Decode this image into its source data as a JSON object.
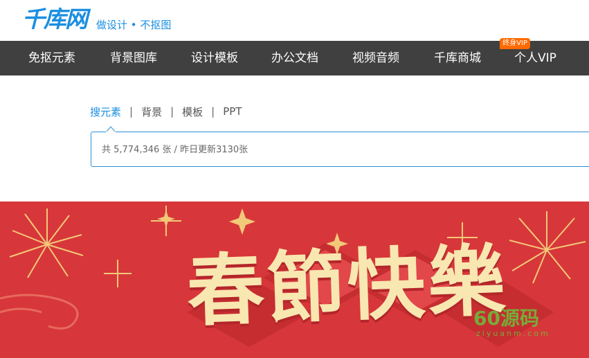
{
  "header": {
    "logo_text": "千库网",
    "tagline": "做设计 • 不抠图"
  },
  "nav": {
    "items": [
      {
        "label": "免抠元素"
      },
      {
        "label": "背景图库"
      },
      {
        "label": "设计模板"
      },
      {
        "label": "办公文档"
      },
      {
        "label": "视频音频"
      },
      {
        "label": "千库商城"
      },
      {
        "label": "个人VIP"
      }
    ],
    "vip_badge": "终身VIP"
  },
  "search": {
    "tabs": [
      {
        "label": "搜元素",
        "active": true
      },
      {
        "label": "背景",
        "active": false
      },
      {
        "label": "模板",
        "active": false
      },
      {
        "label": "PPT",
        "active": false
      }
    ],
    "separator": "|",
    "placeholder": "共 5,774,346 张 / 昨日更新3130张"
  },
  "banner": {
    "title": "春節快樂",
    "background_color": "#d7373a",
    "accent_color": "#f8e7b1"
  },
  "watermark": {
    "main": "60源码",
    "sub": "ziyuanm.com"
  },
  "colors": {
    "brand": "#1a8ee1",
    "nav_bg": "#404040",
    "badge": "#ff6a00"
  }
}
